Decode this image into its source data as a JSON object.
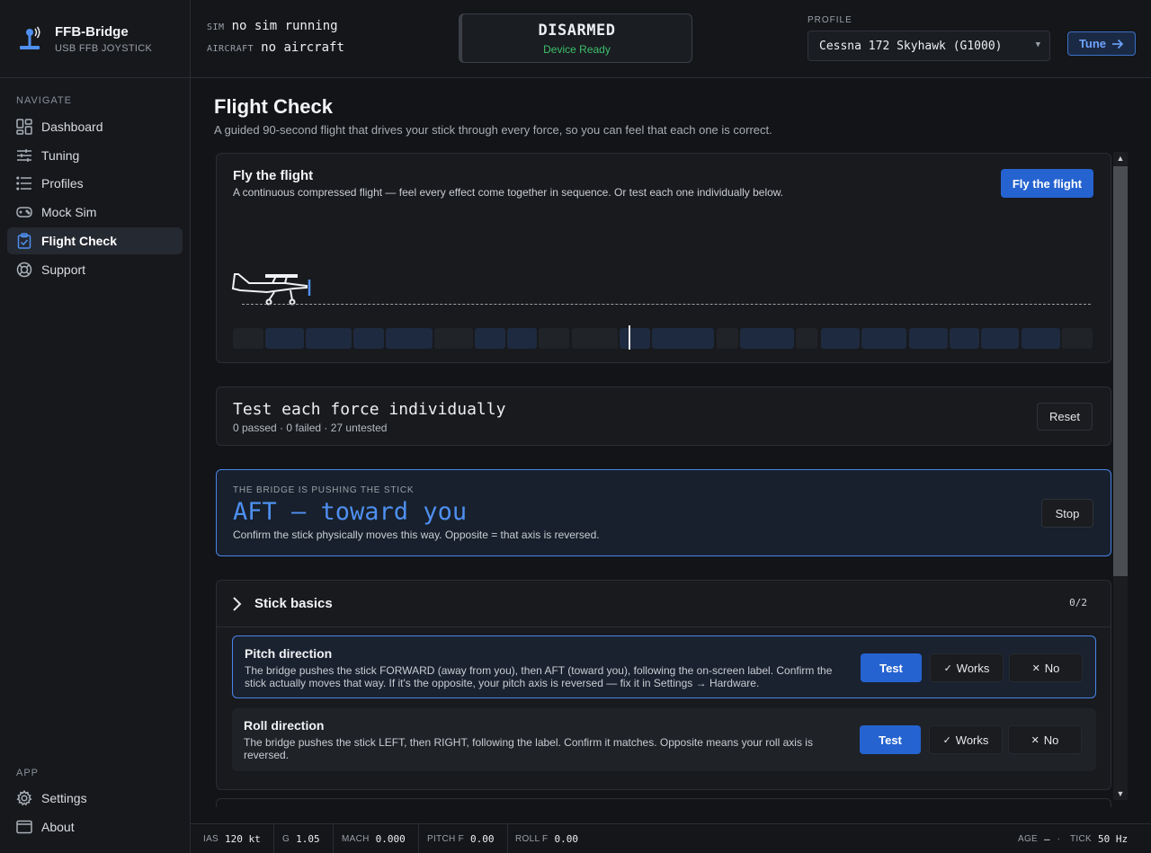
{
  "brand": {
    "title": "FFB-Bridge",
    "subtitle": "USB FFB JOYSTICK"
  },
  "sidebar": {
    "navigate_heading": "NAVIGATE",
    "items": [
      {
        "label": "Dashboard",
        "icon": "dashboard-icon"
      },
      {
        "label": "Tuning",
        "icon": "sliders-icon"
      },
      {
        "label": "Profiles",
        "icon": "list-icon"
      },
      {
        "label": "Mock Sim",
        "icon": "gamepad-icon"
      },
      {
        "label": "Flight Check",
        "icon": "clipboard-check-icon",
        "active": true
      },
      {
        "label": "Support",
        "icon": "lifebuoy-icon"
      }
    ],
    "app_heading": "APP",
    "app_items": [
      {
        "label": "Settings",
        "icon": "gear-icon"
      },
      {
        "label": "About",
        "icon": "window-icon"
      }
    ]
  },
  "topbar": {
    "sim_key": "SIM",
    "sim_value": "no sim running",
    "aircraft_key": "AIRCRAFT",
    "aircraft_value": "no aircraft",
    "arm_state": "DISARMED",
    "arm_sub": "Device Ready",
    "profile_label": "PROFILE",
    "profile_value": "Cessna 172 Skyhawk (G1000)",
    "tune_label": "Tune"
  },
  "page": {
    "title": "Flight Check",
    "description": "A guided 90-second flight that drives your stick through every force, so you can feel that each one is correct."
  },
  "flight": {
    "title": "Fly the flight",
    "description": "A continuous compressed flight — feel every effect come together in sequence. Or test each one individually below.",
    "button": "Fly the flight",
    "playhead_fraction": 0.46
  },
  "tests": {
    "title": "Test each force individually",
    "summary": "0 passed · 0 failed · 27 untested",
    "reset_label": "Reset"
  },
  "push": {
    "label": "THE BRIDGE IS PUSHING THE STICK",
    "direction": "AFT — toward you",
    "note": "Confirm the stick physically moves this way. Opposite = that axis is reversed.",
    "stop_label": "Stop"
  },
  "basics": {
    "title": "Stick basics",
    "count": "0/2",
    "rows": [
      {
        "name": "Pitch direction",
        "desc": "The bridge pushes the stick FORWARD (away from you), then AFT (toward you), following the on-screen label. Confirm the stick actually moves that way. If it's the opposite, your pitch axis is reversed — fix it in Settings → Hardware.",
        "test": "Test",
        "works": "Works",
        "no": "No"
      },
      {
        "name": "Roll direction",
        "desc": "The bridge pushes the stick LEFT, then RIGHT, following the label. Confirm it matches. Opposite means your roll axis is reversed.",
        "test": "Test",
        "works": "Works",
        "no": "No"
      }
    ]
  },
  "status": {
    "ias_k": "IAS",
    "ias_v": "120 kt",
    "g_k": "G",
    "g_v": "1.05",
    "mach_k": "MACH",
    "mach_v": "0.000",
    "pitch_k": "PITCH F",
    "pitch_v": "0.00",
    "roll_k": "ROLL F",
    "roll_v": "0.00",
    "age_k": "AGE",
    "age_v": "—",
    "sep": "·",
    "tick_k": "TICK",
    "tick_v": "50 Hz"
  },
  "colors": {
    "accent": "#2563d0",
    "accent_light": "#4f8ff0",
    "ready": "#3fbf6a"
  }
}
